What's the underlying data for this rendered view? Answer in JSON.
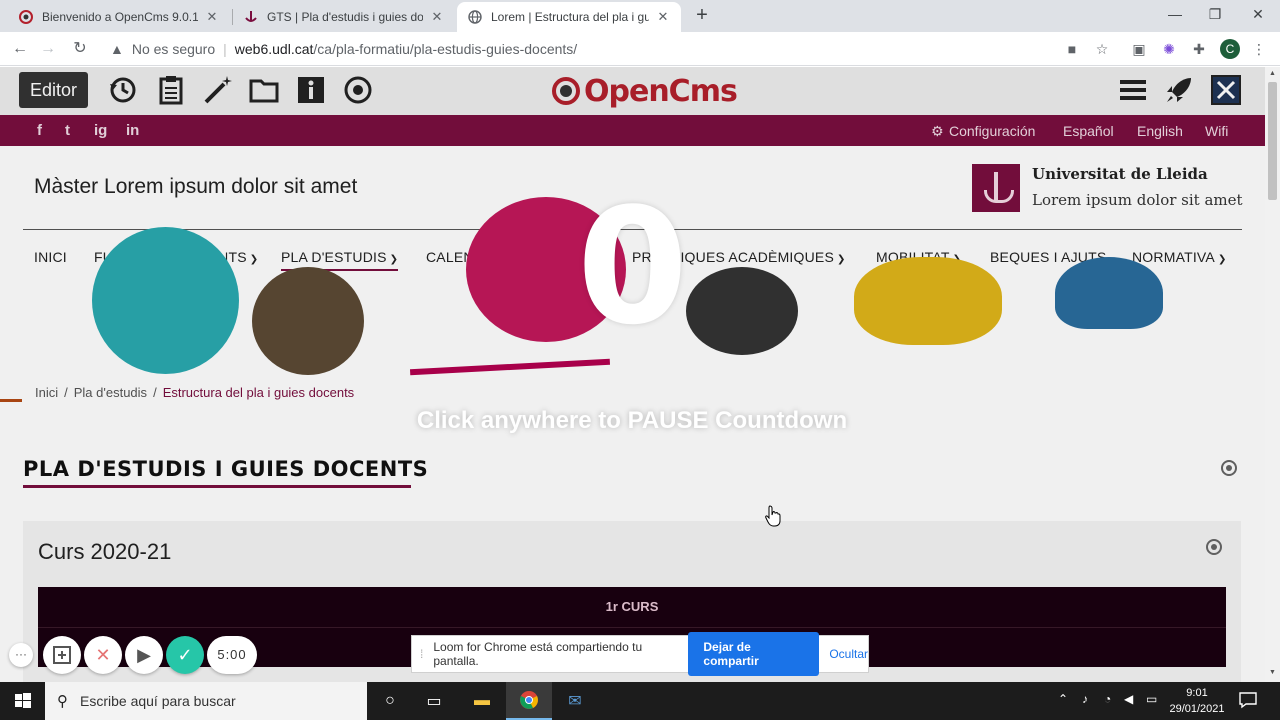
{
  "browser": {
    "tabs": [
      {
        "title": "Bienvenido a OpenCms 9.0.1",
        "favicon": "opencms-favicon-icon",
        "active": false
      },
      {
        "title": "GTS | Pla d'estudis i guies docents",
        "favicon": "udl-favicon-icon",
        "active": false
      },
      {
        "title": "Lorem | Estructura del pla i guies",
        "favicon": "globe-icon",
        "active": true
      }
    ],
    "new_tab": "+",
    "address": {
      "security_label": "No es seguro",
      "host": "web6.udl.cat",
      "path": "/ca/pla-formatiu/pla-estudis-guies-docents/"
    },
    "profile_initial": "C"
  },
  "editor": {
    "label": "Editor",
    "logo_text": "OpenCms",
    "tools": [
      "history-icon",
      "clipboard-icon",
      "magic-wand-icon",
      "folder-icon",
      "info-icon",
      "target-icon"
    ],
    "right_tools": [
      "hamburger-menu-icon",
      "rocket-icon",
      "exit-icon"
    ]
  },
  "site": {
    "social": [
      "f",
      "t",
      "ig",
      "in"
    ],
    "top_links": {
      "config": "Configuración",
      "es": "Español",
      "en": "English",
      "wifi": "Wifi"
    },
    "title": "Màster Lorem ipsum dolor sit amet",
    "uni_name": "Universitat de Lleida",
    "uni_sub": "Lorem ipsum dolor sit amet",
    "menu": [
      {
        "label": "INICI",
        "dropdown": false
      },
      {
        "label": "FUTURS ESTUDIANTS",
        "dropdown": true
      },
      {
        "label": "PLA D'ESTUDIS",
        "dropdown": true,
        "active": true
      },
      {
        "label": "CALENDARIS I HORARIS",
        "dropdown": false
      },
      {
        "label": "PRÀCTIQUES ACADÈMIQUES",
        "dropdown": true
      },
      {
        "label": "MOBILITAT",
        "dropdown": true
      },
      {
        "label": "BEQUES I AJUTS",
        "dropdown": false
      },
      {
        "label": "NORMATIVA",
        "dropdown": true
      }
    ],
    "breadcrumb": [
      "Inici",
      "/",
      "Pla d'estudis",
      "/",
      "Estructura del pla i guies docents"
    ],
    "section_heading": "PLA D'ESTUDIS I GUIES DOCENTS",
    "course_heading": "Curs 2020-21",
    "course_table_head": "1r CURS"
  },
  "overlay": {
    "countdown": "0",
    "message": "Click anywhere to PAUSE Countdown"
  },
  "loom": {
    "menu": "···",
    "timer": "5:00",
    "share_text": "Loom for Chrome está compartiendo tu pantalla.",
    "stop_label": "Dejar de compartir",
    "hide_label": "Ocultar"
  },
  "taskbar": {
    "search_placeholder": "Escribe aquí para buscar",
    "time": "9:01",
    "date": "29/01/2021"
  },
  "colors": {
    "brand": "#7a0e3f",
    "opencms_red": "#b3202c",
    "loom_blue": "#1a73e8"
  }
}
